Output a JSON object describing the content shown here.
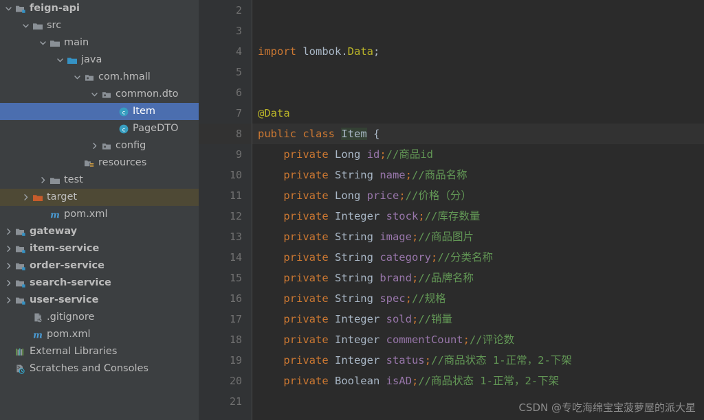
{
  "sidebar": {
    "rows": [
      {
        "label": "feign-api",
        "indent": 0,
        "arrow": "down",
        "icon": "module-folder-icon",
        "bold": true,
        "state": "normal"
      },
      {
        "label": "src",
        "indent": 1,
        "arrow": "down",
        "icon": "folder-icon",
        "bold": false,
        "state": "normal"
      },
      {
        "label": "main",
        "indent": 2,
        "arrow": "down",
        "icon": "folder-icon",
        "bold": false,
        "state": "normal"
      },
      {
        "label": "java",
        "indent": 3,
        "arrow": "down",
        "icon": "source-folder-icon",
        "bold": false,
        "state": "normal"
      },
      {
        "label": "com.hmall",
        "indent": 4,
        "arrow": "down",
        "icon": "package-icon",
        "bold": false,
        "state": "normal"
      },
      {
        "label": "common.dto",
        "indent": 5,
        "arrow": "down",
        "icon": "package-icon",
        "bold": false,
        "state": "normal"
      },
      {
        "label": "Item",
        "indent": 6,
        "arrow": "none",
        "icon": "java-class-icon",
        "bold": false,
        "state": "selected"
      },
      {
        "label": "PageDTO",
        "indent": 6,
        "arrow": "none",
        "icon": "java-class-icon",
        "bold": false,
        "state": "normal"
      },
      {
        "label": "config",
        "indent": 5,
        "arrow": "right",
        "icon": "package-icon",
        "bold": false,
        "state": "normal"
      },
      {
        "label": "resources",
        "indent": 4,
        "arrow": "none",
        "icon": "resources-folder-icon",
        "bold": false,
        "state": "normal"
      },
      {
        "label": "test",
        "indent": 2,
        "arrow": "right",
        "icon": "folder-icon",
        "bold": false,
        "state": "normal"
      },
      {
        "label": "target",
        "indent": 1,
        "arrow": "right",
        "icon": "target-folder-icon",
        "bold": false,
        "state": "highlighted"
      },
      {
        "label": "pom.xml",
        "indent": 2,
        "arrow": "none",
        "icon": "maven-file-icon",
        "bold": false,
        "state": "normal"
      },
      {
        "label": "gateway",
        "indent": 0,
        "arrow": "right",
        "icon": "module-folder-icon",
        "bold": true,
        "state": "normal"
      },
      {
        "label": "item-service",
        "indent": 0,
        "arrow": "right",
        "icon": "module-folder-icon",
        "bold": true,
        "state": "normal"
      },
      {
        "label": "order-service",
        "indent": 0,
        "arrow": "right",
        "icon": "module-folder-icon",
        "bold": true,
        "state": "normal"
      },
      {
        "label": "search-service",
        "indent": 0,
        "arrow": "right",
        "icon": "module-folder-icon",
        "bold": true,
        "state": "normal"
      },
      {
        "label": "user-service",
        "indent": 0,
        "arrow": "right",
        "icon": "module-folder-icon",
        "bold": true,
        "state": "normal"
      },
      {
        "label": ".gitignore",
        "indent": 1,
        "arrow": "none",
        "icon": "gitignore-file-icon",
        "bold": false,
        "state": "normal"
      },
      {
        "label": "pom.xml",
        "indent": 1,
        "arrow": "none",
        "icon": "maven-file-icon",
        "bold": false,
        "state": "normal"
      },
      {
        "label": "External Libraries",
        "indent": 0,
        "arrow": "none",
        "icon": "libraries-icon",
        "bold": false,
        "state": "normal"
      },
      {
        "label": "Scratches and Consoles",
        "indent": 0,
        "arrow": "none",
        "icon": "scratches-icon",
        "bold": false,
        "state": "normal"
      }
    ]
  },
  "editor": {
    "first_line_number": 2,
    "caret_line_number": 8,
    "lines": [
      {
        "n": 2,
        "tokens": []
      },
      {
        "n": 3,
        "tokens": []
      },
      {
        "n": 4,
        "tokens": [
          {
            "t": "import ",
            "c": "kw"
          },
          {
            "t": "lombok.",
            "c": "pkg"
          },
          {
            "t": "Data",
            "c": "ann"
          },
          {
            "t": ";",
            "c": "punc"
          }
        ]
      },
      {
        "n": 5,
        "tokens": []
      },
      {
        "n": 6,
        "tokens": []
      },
      {
        "n": 7,
        "tokens": [
          {
            "t": "@Data",
            "c": "ann"
          }
        ]
      },
      {
        "n": 8,
        "tokens": [
          {
            "t": "public class ",
            "c": "kw"
          },
          {
            "t": "Item",
            "c": "cls cls-hl"
          },
          {
            "t": " {",
            "c": "punc"
          }
        ]
      },
      {
        "n": 9,
        "tokens": [
          {
            "t": "    private ",
            "c": "kw"
          },
          {
            "t": "Long ",
            "c": "type"
          },
          {
            "t": "id",
            "c": "fld"
          },
          {
            "t": ";",
            "c": "semi"
          },
          {
            "t": "//商品id",
            "c": "cmt"
          }
        ]
      },
      {
        "n": 10,
        "tokens": [
          {
            "t": "    private ",
            "c": "kw"
          },
          {
            "t": "String ",
            "c": "type"
          },
          {
            "t": "name",
            "c": "fld"
          },
          {
            "t": ";",
            "c": "semi"
          },
          {
            "t": "//商品名称",
            "c": "cmt"
          }
        ]
      },
      {
        "n": 11,
        "tokens": [
          {
            "t": "    private ",
            "c": "kw"
          },
          {
            "t": "Long ",
            "c": "type"
          },
          {
            "t": "price",
            "c": "fld"
          },
          {
            "t": ";",
            "c": "semi"
          },
          {
            "t": "//价格（分）",
            "c": "cmt"
          }
        ]
      },
      {
        "n": 12,
        "tokens": [
          {
            "t": "    private ",
            "c": "kw"
          },
          {
            "t": "Integer ",
            "c": "type"
          },
          {
            "t": "stock",
            "c": "fld"
          },
          {
            "t": ";",
            "c": "semi"
          },
          {
            "t": "//库存数量",
            "c": "cmt"
          }
        ]
      },
      {
        "n": 13,
        "tokens": [
          {
            "t": "    private ",
            "c": "kw"
          },
          {
            "t": "String ",
            "c": "type"
          },
          {
            "t": "image",
            "c": "fld"
          },
          {
            "t": ";",
            "c": "semi"
          },
          {
            "t": "//商品图片",
            "c": "cmt"
          }
        ]
      },
      {
        "n": 14,
        "tokens": [
          {
            "t": "    private ",
            "c": "kw"
          },
          {
            "t": "String ",
            "c": "type"
          },
          {
            "t": "category",
            "c": "fld"
          },
          {
            "t": ";",
            "c": "semi"
          },
          {
            "t": "//分类名称",
            "c": "cmt"
          }
        ]
      },
      {
        "n": 15,
        "tokens": [
          {
            "t": "    private ",
            "c": "kw"
          },
          {
            "t": "String ",
            "c": "type"
          },
          {
            "t": "brand",
            "c": "fld"
          },
          {
            "t": ";",
            "c": "semi"
          },
          {
            "t": "//品牌名称",
            "c": "cmt"
          }
        ]
      },
      {
        "n": 16,
        "tokens": [
          {
            "t": "    private ",
            "c": "kw"
          },
          {
            "t": "String ",
            "c": "type"
          },
          {
            "t": "spec",
            "c": "fld"
          },
          {
            "t": ";",
            "c": "semi"
          },
          {
            "t": "//规格",
            "c": "cmt"
          }
        ]
      },
      {
        "n": 17,
        "tokens": [
          {
            "t": "    private ",
            "c": "kw"
          },
          {
            "t": "Integer ",
            "c": "type"
          },
          {
            "t": "sold",
            "c": "fld"
          },
          {
            "t": ";",
            "c": "semi"
          },
          {
            "t": "//销量",
            "c": "cmt"
          }
        ]
      },
      {
        "n": 18,
        "tokens": [
          {
            "t": "    private ",
            "c": "kw"
          },
          {
            "t": "Integer ",
            "c": "type"
          },
          {
            "t": "commentCount",
            "c": "fld"
          },
          {
            "t": ";",
            "c": "semi"
          },
          {
            "t": "//评论数",
            "c": "cmt"
          }
        ]
      },
      {
        "n": 19,
        "tokens": [
          {
            "t": "    private ",
            "c": "kw"
          },
          {
            "t": "Integer ",
            "c": "type"
          },
          {
            "t": "status",
            "c": "fld"
          },
          {
            "t": ";",
            "c": "semi"
          },
          {
            "t": "//商品状态 1-正常，2-下架",
            "c": "cmt"
          }
        ]
      },
      {
        "n": 20,
        "tokens": [
          {
            "t": "    private ",
            "c": "kw"
          },
          {
            "t": "Boolean ",
            "c": "type"
          },
          {
            "t": "isAD",
            "c": "fld"
          },
          {
            "t": ";",
            "c": "semi"
          },
          {
            "t": "//商品状态 1-正常，2-下架",
            "c": "cmt"
          }
        ]
      },
      {
        "n": 21,
        "tokens": []
      }
    ]
  },
  "watermark": {
    "text": "CSDN @专吃海绵宝宝菠萝屋的派大星"
  },
  "colors": {
    "sidebar_bg": "#3c3f41",
    "editor_bg": "#2b2b2b",
    "gutter_bg": "#313335",
    "selection_blue": "#4b6eaf",
    "target_highlight": "#4e4935",
    "caret_line": "#323232",
    "keyword_orange": "#cc7832",
    "field_purple": "#9876aa",
    "comment_green": "#629755",
    "annotation_yellow": "#bbb529",
    "text_default": "#a9b7c6",
    "tree_text": "#bbbbbb"
  }
}
